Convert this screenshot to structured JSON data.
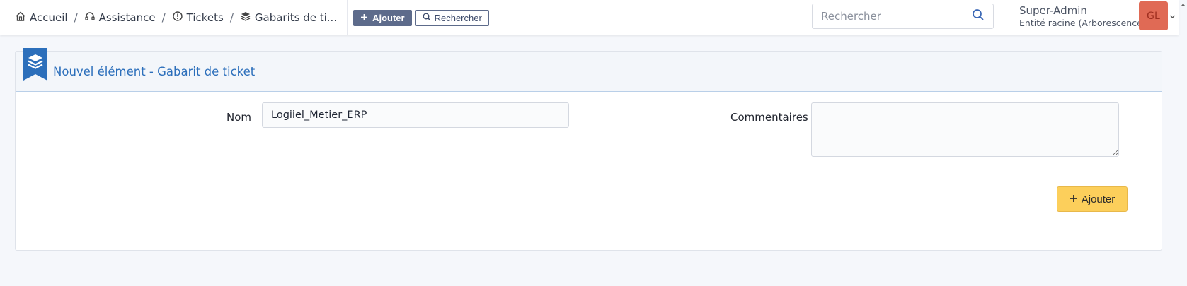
{
  "breadcrumb": {
    "home": "Accueil",
    "assistance": "Assistance",
    "tickets": "Tickets",
    "templates": "Gabarits de ti...",
    "separator": "/"
  },
  "toolbar": {
    "add_label": "Ajouter",
    "search_label": "Rechercher"
  },
  "global_search": {
    "placeholder": "Rechercher"
  },
  "user": {
    "name": "Super-Admin",
    "entity": "Entité racine (Arborescence)",
    "initials": "GL"
  },
  "form": {
    "title": "Nouvel élément - Gabarit de ticket",
    "name_label": "Nom",
    "name_value": "Logiiel_Metier_ERP",
    "comments_label": "Commentaires",
    "comments_value": "",
    "submit_label": "Ajouter"
  },
  "colors": {
    "accent": "#2c6fbb",
    "toolbar_button": "#5d6b8b",
    "submit_button": "#fccf5b",
    "avatar_bg": "#e06a55"
  }
}
